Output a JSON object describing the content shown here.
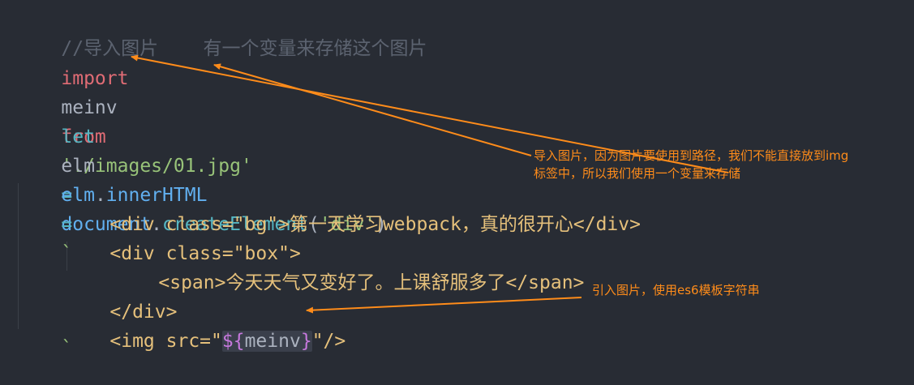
{
  "code": {
    "line1": {
      "comment": "//导入图片    有一个变量来存储这个图片"
    },
    "line2": {
      "kw_import": "import",
      "ident": "meinv",
      "kw_from": "from",
      "string": "'./images/01.jpg'"
    },
    "line4": {
      "kw_let": "let",
      "ident": "elm",
      "eq": "=",
      "obj": "document",
      "dot": ".",
      "method": "createElement",
      "paren_open": "(",
      "arg": "'div'",
      "paren_close": ")"
    },
    "line6": {
      "ident": "elm",
      "dot": ".",
      "prop": "innerHTML",
      "eq": "=",
      "tick": "`"
    },
    "line7": {
      "text": "<div class=\"bg\">第一天学习webpack，真的很开心</div>"
    },
    "line8": {
      "text": "<div class=\"box\">"
    },
    "line9": {
      "text": "<span>今天天气又变好了。上课舒服多了</span>"
    },
    "line10": {
      "text": "</div>"
    },
    "line11": {
      "pre": "<img src=\"",
      "interp_open": "${",
      "interp_var": "meinv",
      "interp_close": "}",
      "post": "\"/>"
    },
    "line12": {
      "tick": "`"
    }
  },
  "annotations": {
    "note1_line1": "导入图片，因为图片要使用到路径，我们不能直接放到img",
    "note1_line2": "标签中，所以我们使用一个变量来存储",
    "note2": "引入图片，使用es6模板字符串"
  },
  "colors": {
    "background": "#282c34",
    "annotation": "#ff8c1a"
  }
}
